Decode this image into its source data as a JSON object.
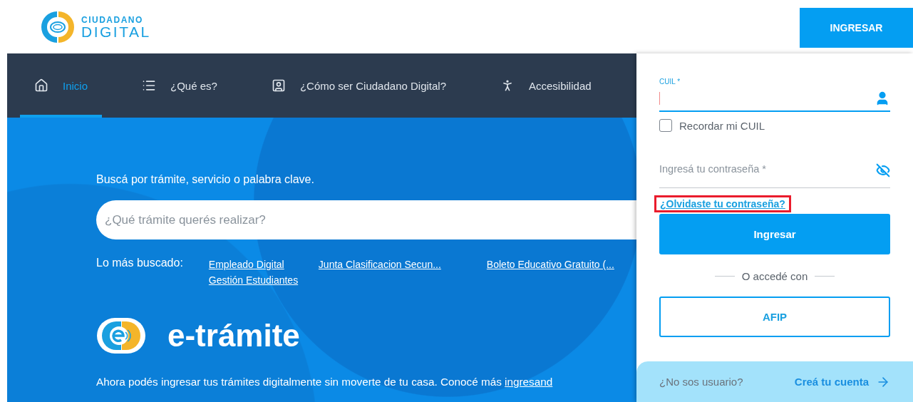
{
  "header": {
    "logo": {
      "line_1": "CIUDADANO",
      "line_2": "DIGITAL"
    },
    "login_button": "INGRESAR"
  },
  "nav": [
    {
      "label": "Inicio",
      "selected": true
    },
    {
      "label": "¿Qué es?",
      "selected": false
    },
    {
      "label": "¿Cómo ser Ciudadano Digital?",
      "selected": false
    },
    {
      "label": "Accesibilidad",
      "selected": false
    }
  ],
  "hero": {
    "search_prompt": "Buscá por trámite, servicio o palabra clave.",
    "search": {
      "placeholder": "¿Qué trámite querés realizar?"
    },
    "popular": {
      "label": "Lo más buscado:",
      "links": [
        "Empleado Digital",
        "Junta Clasificacion Secun...",
        "Boleto Educativo Gratuito (...",
        "Gestión Estudiantes"
      ]
    },
    "product": {
      "name": "e-trámite"
    },
    "intro": {
      "text": "Ahora podés ingresar tus trámites digitalmente sin moverte de tu casa. Conocé más ",
      "link": "ingresand"
    }
  },
  "login": {
    "cuil": {
      "label": "CUIL *",
      "focused": true
    },
    "remember": {
      "label": "Recordar mi CUIL",
      "checked": false
    },
    "password": {
      "placeholder": "Ingresá tu contraseña *"
    },
    "forgot_link": {
      "label": "¿Olvidaste tu contraseña?",
      "highlighted": true
    },
    "submit": "Ingresar",
    "divider": "O accedé con",
    "afip": "AFIP",
    "signup": {
      "prompt": "¿No sos usuario?",
      "link": "Creá tu cuenta"
    }
  }
}
